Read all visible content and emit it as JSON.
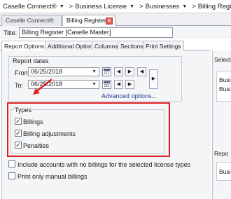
{
  "breadcrumb": {
    "items": [
      "Caselle Connect®",
      "Business License",
      "Businesses",
      "Billing Register"
    ]
  },
  "doc_tabs": [
    "Caselle Connect®",
    "Billing Register"
  ],
  "title_row": {
    "label": "Title:",
    "value": "Billing Register [Caselle Master]"
  },
  "option_tabs": [
    "Report Options",
    "Additional Options",
    "Columns",
    "Sections",
    "Print Settings"
  ],
  "report_dates": {
    "heading": "Report dates",
    "from_label": "From:",
    "from_value": "06/25/2018",
    "to_label": "To:",
    "to_value": "06/25/2018",
    "advanced_link": "Advanced options..."
  },
  "types": {
    "heading": "Types",
    "items": [
      {
        "label": "Billings",
        "checked": true
      },
      {
        "label": "Billing adjustments",
        "checked": true
      },
      {
        "label": "Penalties",
        "checked": true
      }
    ]
  },
  "options": [
    {
      "label": "Include accounts with no billings for the selected license types",
      "checked": false
    },
    {
      "label": "Print only manual billings",
      "checked": false
    }
  ],
  "right_pane": {
    "header": "Select",
    "items": [
      "Busin",
      "Busin"
    ],
    "header2": "Repo",
    "items2": [
      "Busin"
    ]
  },
  "colors": {
    "annotation_red": "#e02020",
    "link_blue": "#1f3f8f"
  },
  "icons": {
    "calendar": "calendar-icon",
    "prev": "triangle-left",
    "next": "triangle-right",
    "close": "x"
  }
}
